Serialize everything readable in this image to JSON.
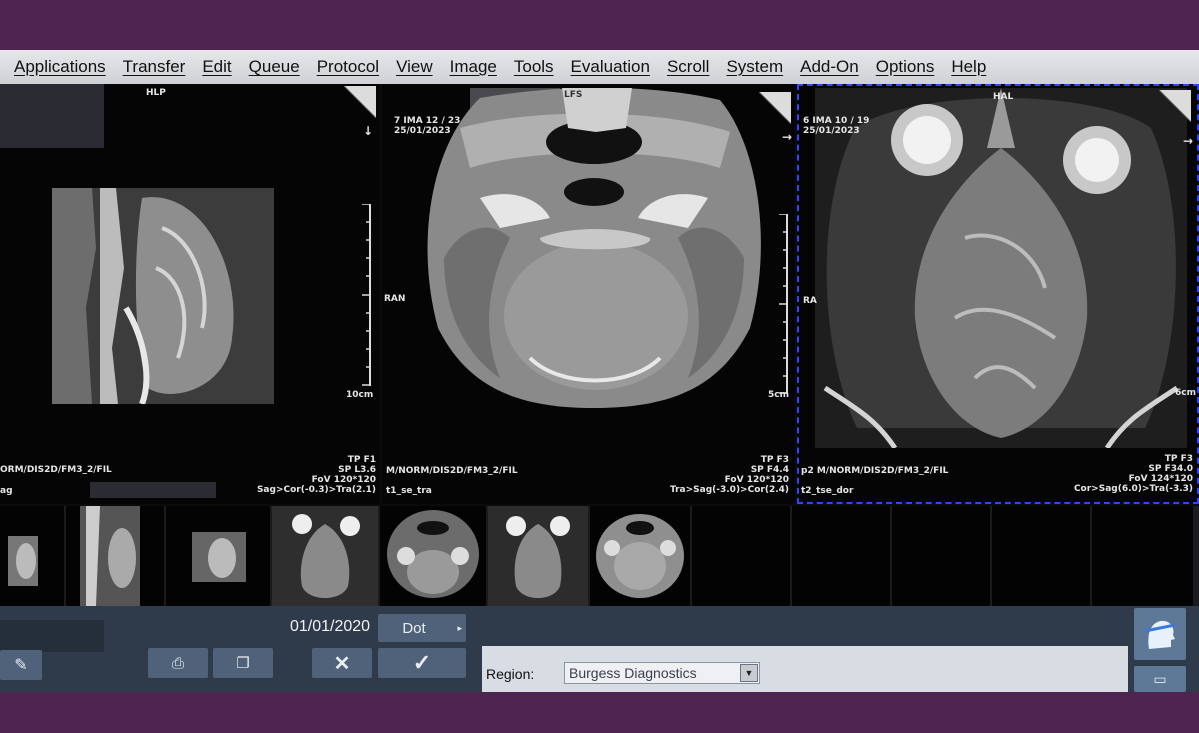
{
  "menu": [
    "Applications",
    "Transfer",
    "Edit",
    "Queue",
    "Protocol",
    "View",
    "Image",
    "Tools",
    "Evaluation",
    "Scroll",
    "System",
    "Add-On",
    "Options",
    "Help"
  ],
  "viewport1": {
    "orientation_top": "HLP",
    "scale_label": "10cm",
    "bottom_right": [
      "TP F1",
      "SP L3.6",
      "FoV 120*120",
      "Sag>Cor(-0.3)>Tra(2.1)"
    ],
    "bottom_left": [
      "ORM/DIS2D/FM3_2/FIL",
      "ag"
    ]
  },
  "viewport2": {
    "header": [
      "7 IMA 12 / 23",
      "25/01/2023"
    ],
    "orientation_top": "LFS",
    "orientation_left": "RAN",
    "scale_label": "5cm",
    "bottom_right": [
      "TP F3",
      "SP F4.4",
      "FoV 120*120",
      "Tra>Sag(-3.0)>Cor(2.4)"
    ],
    "bottom_left": [
      "M/NORM/DIS2D/FM3_2/FIL",
      "t1_se_tra"
    ]
  },
  "viewport3": {
    "header": [
      "6 IMA 10 / 19",
      "25/01/2023"
    ],
    "orientation_top": "HAL",
    "orientation_left": "RA",
    "scale_label": "6cm",
    "bottom_right": [
      "TP F3",
      "SP F34.0",
      "FoV 124*120",
      "Cor>Sag(6.0)>Tra(-3.3)"
    ],
    "bottom_left": [
      "p2 M/NORM/DIS2D/FM3_2/FIL",
      "t2_tse_dor"
    ]
  },
  "panel": {
    "date": "01/01/2020",
    "dot_label": "Dot",
    "region_label": "Region:",
    "region_value": "Burgess Diagnostics"
  }
}
